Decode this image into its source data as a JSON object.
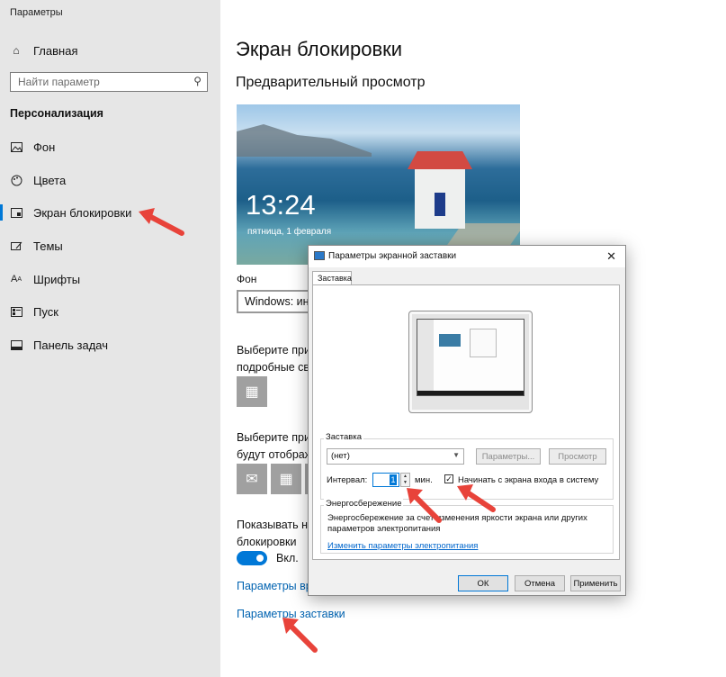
{
  "app": {
    "title": "Параметры"
  },
  "sidebar": {
    "home_label": "Главная",
    "search_placeholder": "Найти параметр",
    "section_title": "Персонализация",
    "items": [
      {
        "label": "Фон",
        "icon": "picture-icon"
      },
      {
        "label": "Цвета",
        "icon": "palette-icon"
      },
      {
        "label": "Экран блокировки",
        "icon": "lock-screen-icon",
        "active": true
      },
      {
        "label": "Темы",
        "icon": "brush-icon"
      },
      {
        "label": "Шрифты",
        "icon": "font-icon"
      },
      {
        "label": "Пуск",
        "icon": "start-icon"
      },
      {
        "label": "Панель задач",
        "icon": "taskbar-icon"
      }
    ]
  },
  "main": {
    "page_title": "Экран блокировки",
    "preview_title": "Предварительный просмотр",
    "preview_time": "13:24",
    "preview_date": "пятница, 1 февраля",
    "background_label": "Фон",
    "background_value": "Windows: инт",
    "choose_app_detailed_line1": "Выберите прил",
    "choose_app_detailed_line2": "подробные свед",
    "choose_apps_quick_line1": "Выберите прил",
    "choose_apps_quick_line2": "будут отображ",
    "show_bg_line1": "Показывать на",
    "show_bg_line2": "блокировки",
    "toggle_label": "Вкл.",
    "timeout_link": "Параметры вре",
    "screensaver_link": "Параметры заставки"
  },
  "dialog": {
    "title": "Параметры экранной заставки",
    "tab": "Заставка",
    "screensaver_group": "Заставка",
    "screensaver_value": "(нет)",
    "settings_button": "Параметры...",
    "preview_button": "Просмотр",
    "interval_label": "Интервал:",
    "interval_value": "1",
    "interval_unit": "мин.",
    "resume_checkbox_label": "Начинать с экрана входа в систему",
    "resume_checked": true,
    "power_group": "Энергосбережение",
    "power_text_line1": "Энергосбережение за счет изменения яркости экрана или других",
    "power_text_line2": "параметров электропитания",
    "power_link": "Изменить параметры электропитания",
    "ok_button": "ОК",
    "cancel_button": "Отмена",
    "apply_button": "Применить",
    "close_glyph": "✕"
  },
  "colors": {
    "accent": "#0078d7",
    "annotation_arrow": "#e8433a"
  }
}
